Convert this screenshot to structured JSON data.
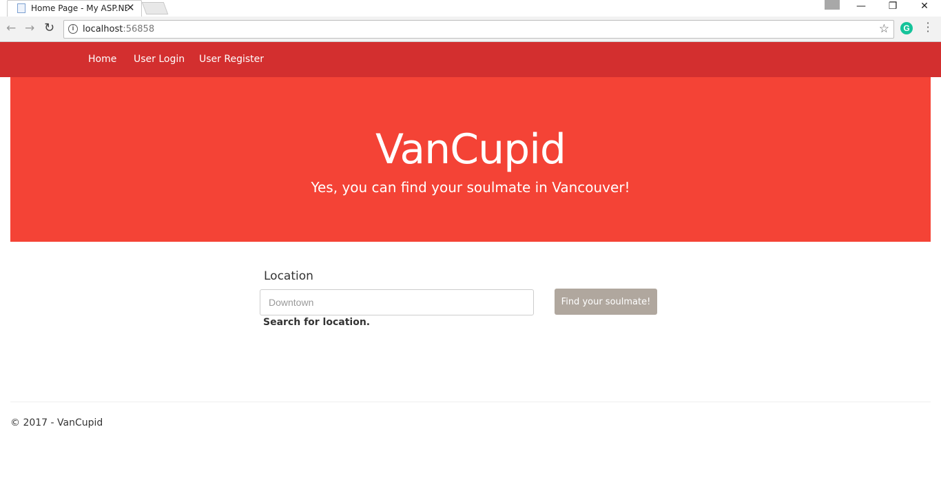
{
  "browser": {
    "tab_title": "Home Page - My ASP.NE",
    "tab_close": "✕",
    "url_host": "localhost",
    "url_port": ":56858",
    "minimize": "—",
    "restore": "❐",
    "close": "✕",
    "icons": [
      "back-arrow-icon",
      "forward-arrow-icon",
      "reload-icon",
      "info-icon",
      "star-icon",
      "grammarly-icon",
      "kebab-menu-icon",
      "profile-icon"
    ]
  },
  "navbar": {
    "items": [
      {
        "label": "Home"
      },
      {
        "label": "User Login"
      },
      {
        "label": "User Register"
      }
    ],
    "color": "#d32f2f"
  },
  "hero": {
    "title": "VanCupid",
    "subtitle": "Yes, you can find your soulmate in Vancouver!",
    "color": "#f44336"
  },
  "search": {
    "label": "Location",
    "placeholder": "Downtown",
    "value": "",
    "help": "Search for location.",
    "button_label": "Find your soulmate!",
    "button_color": "#b0a79e"
  },
  "footer": {
    "text": "© 2017 - VanCupid"
  }
}
